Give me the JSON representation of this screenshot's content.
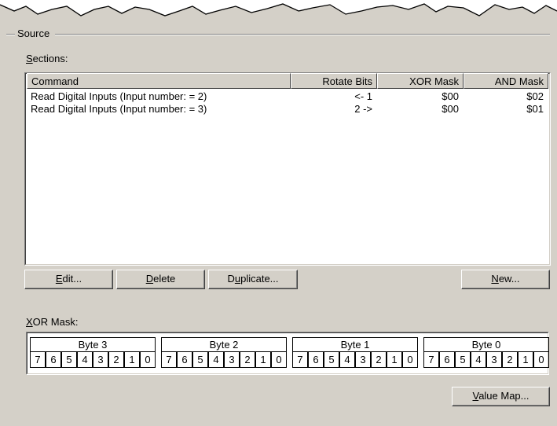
{
  "source_group": {
    "label": "Source"
  },
  "sections": {
    "label_accel": "S",
    "label_rest": "ections:",
    "columns": [
      "Command",
      "Rotate Bits",
      "XOR Mask",
      "AND Mask"
    ],
    "rows": [
      {
        "command": "Read Digital Inputs (Input number: = 2)",
        "rotate": "<- 1",
        "xor": "$00",
        "and": "$02"
      },
      {
        "command": "Read Digital Inputs (Input number: = 3)",
        "rotate": "2 ->",
        "xor": "$00",
        "and": "$01"
      }
    ]
  },
  "buttons": {
    "edit": {
      "accel": "E",
      "rest": "dit..."
    },
    "delete": {
      "accel": "D",
      "rest": "elete"
    },
    "duplicate": {
      "pre": "D",
      "accel": "u",
      "rest": "plicate..."
    },
    "new": {
      "accel": "N",
      "rest": "ew..."
    },
    "value_map": {
      "accel": "V",
      "rest": "alue Map..."
    }
  },
  "xor_mask": {
    "label_accel": "X",
    "label_rest": "OR Mask:",
    "bytes": [
      {
        "title": "Byte 3",
        "bits": [
          "7",
          "6",
          "5",
          "4",
          "3",
          "2",
          "1",
          "0"
        ]
      },
      {
        "title": "Byte 2",
        "bits": [
          "7",
          "6",
          "5",
          "4",
          "3",
          "2",
          "1",
          "0"
        ]
      },
      {
        "title": "Byte 1",
        "bits": [
          "7",
          "6",
          "5",
          "4",
          "3",
          "2",
          "1",
          "0"
        ]
      },
      {
        "title": "Byte 0",
        "bits": [
          "7",
          "6",
          "5",
          "4",
          "3",
          "2",
          "1",
          "0"
        ]
      }
    ]
  },
  "colors": {
    "face": "#d4d0c8",
    "window": "#ffffff",
    "shadow": "#808080",
    "dark": "#404040"
  }
}
